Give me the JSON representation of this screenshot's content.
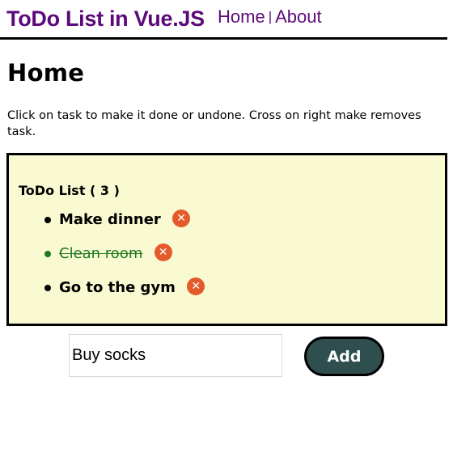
{
  "header": {
    "brand": "ToDo List in Vue.JS",
    "nav": [
      {
        "label": "Home"
      },
      {
        "label": "About"
      }
    ],
    "separator": "|"
  },
  "page": {
    "title": "Home",
    "intro": "Click on task to make it done or undone. Cross on right make removes task."
  },
  "todo": {
    "heading": "ToDo List ( 3 )",
    "items": [
      {
        "text": "Make dinner",
        "done": false
      },
      {
        "text": "Clean room",
        "done": true
      },
      {
        "text": "Go to the gym",
        "done": false
      }
    ],
    "remove_glyph": "✕"
  },
  "input": {
    "value": "Buy socks"
  },
  "add_button": {
    "label": "Add"
  },
  "colors": {
    "brand": "#5c0a7a",
    "list_background": "#fafad2",
    "done_text": "#1f7a1f",
    "remove_icon": "#e45a2a",
    "add_button": "#2f4f4f"
  }
}
